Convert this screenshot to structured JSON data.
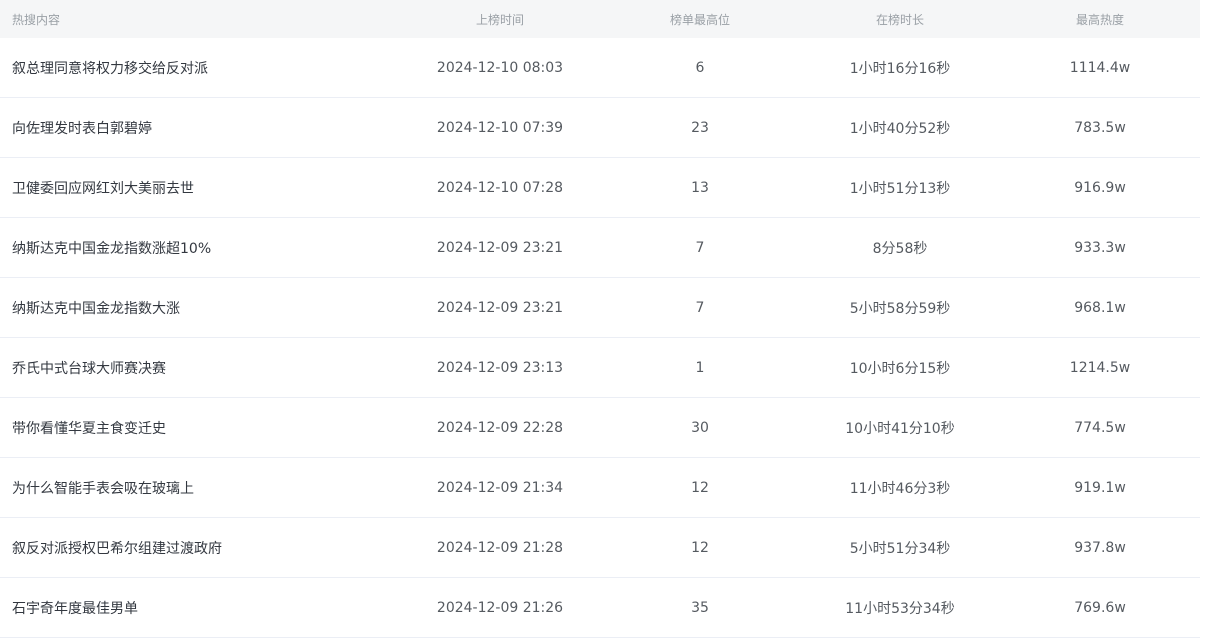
{
  "header": {
    "columns": [
      "热搜内容",
      "上榜时间",
      "榜单最高位",
      "在榜时长",
      "最高热度"
    ]
  },
  "rows": [
    {
      "title": "叙总理同意将权力移交给反对派",
      "time": "2024-12-10 08:03",
      "rank": "6",
      "duration": "1小时16分16秒",
      "heat": "1114.4w"
    },
    {
      "title": "向佐理发时表白郭碧婷",
      "time": "2024-12-10 07:39",
      "rank": "23",
      "duration": "1小时40分52秒",
      "heat": "783.5w"
    },
    {
      "title": "卫健委回应网红刘大美丽去世",
      "time": "2024-12-10 07:28",
      "rank": "13",
      "duration": "1小时51分13秒",
      "heat": "916.9w"
    },
    {
      "title": "纳斯达克中国金龙指数涨超10%",
      "time": "2024-12-09 23:21",
      "rank": "7",
      "duration": "8分58秒",
      "heat": "933.3w"
    },
    {
      "title": "纳斯达克中国金龙指数大涨",
      "time": "2024-12-09 23:21",
      "rank": "7",
      "duration": "5小时58分59秒",
      "heat": "968.1w"
    },
    {
      "title": "乔氏中式台球大师赛决赛",
      "time": "2024-12-09 23:13",
      "rank": "1",
      "duration": "10小时6分15秒",
      "heat": "1214.5w"
    },
    {
      "title": "带你看懂华夏主食变迁史",
      "time": "2024-12-09 22:28",
      "rank": "30",
      "duration": "10小时41分10秒",
      "heat": "774.5w"
    },
    {
      "title": "为什么智能手表会吸在玻璃上",
      "time": "2024-12-09 21:34",
      "rank": "12",
      "duration": "11小时46分3秒",
      "heat": "919.1w"
    },
    {
      "title": "叙反对派授权巴希尔组建过渡政府",
      "time": "2024-12-09 21:28",
      "rank": "12",
      "duration": "5小时51分34秒",
      "heat": "937.8w"
    },
    {
      "title": "石宇奇年度最佳男单",
      "time": "2024-12-09 21:26",
      "rank": "35",
      "duration": "11小时53分34秒",
      "heat": "769.6w"
    }
  ]
}
